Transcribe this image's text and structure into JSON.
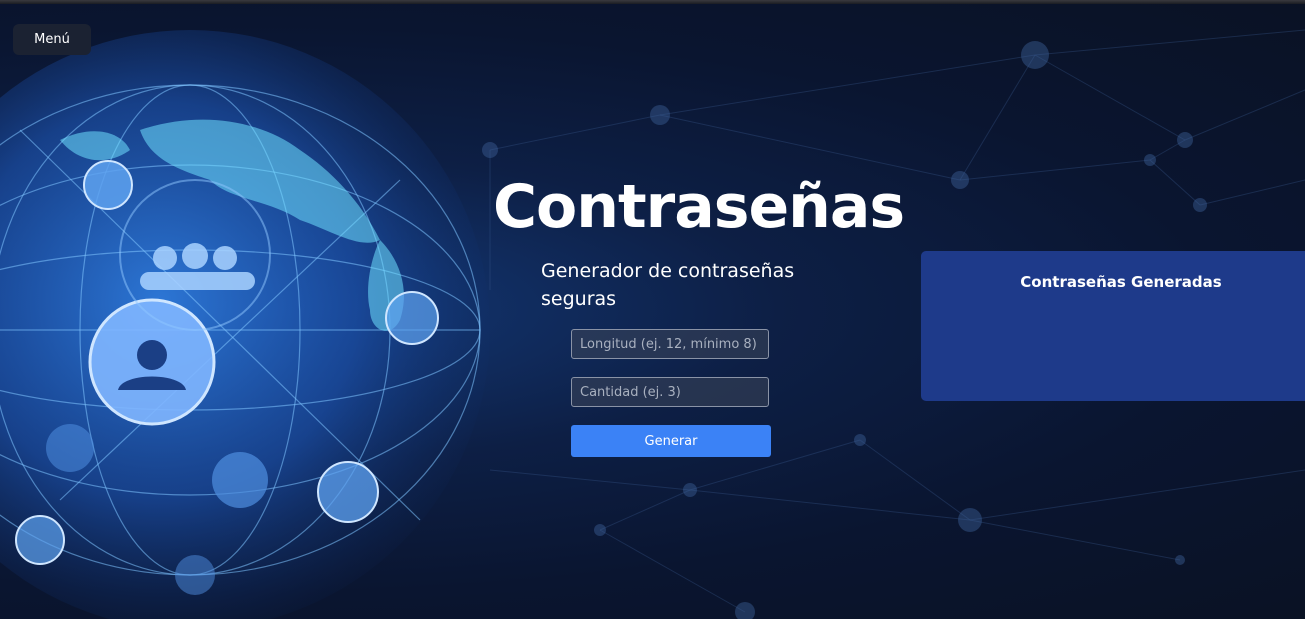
{
  "menu": {
    "label": "Menú"
  },
  "hero": {
    "title": "Contraseñas",
    "subtitle": "Generador de contraseñas seguras"
  },
  "form": {
    "length_placeholder": "Longitud (ej. 12, mínimo 8)",
    "quantity_placeholder": "Cantidad (ej. 3)",
    "generate_label": "Generar"
  },
  "results": {
    "title": "Contraseñas Generadas"
  },
  "colors": {
    "accent": "#3b82f6",
    "panel": "#1e3a8a",
    "background": "#0b1426"
  }
}
